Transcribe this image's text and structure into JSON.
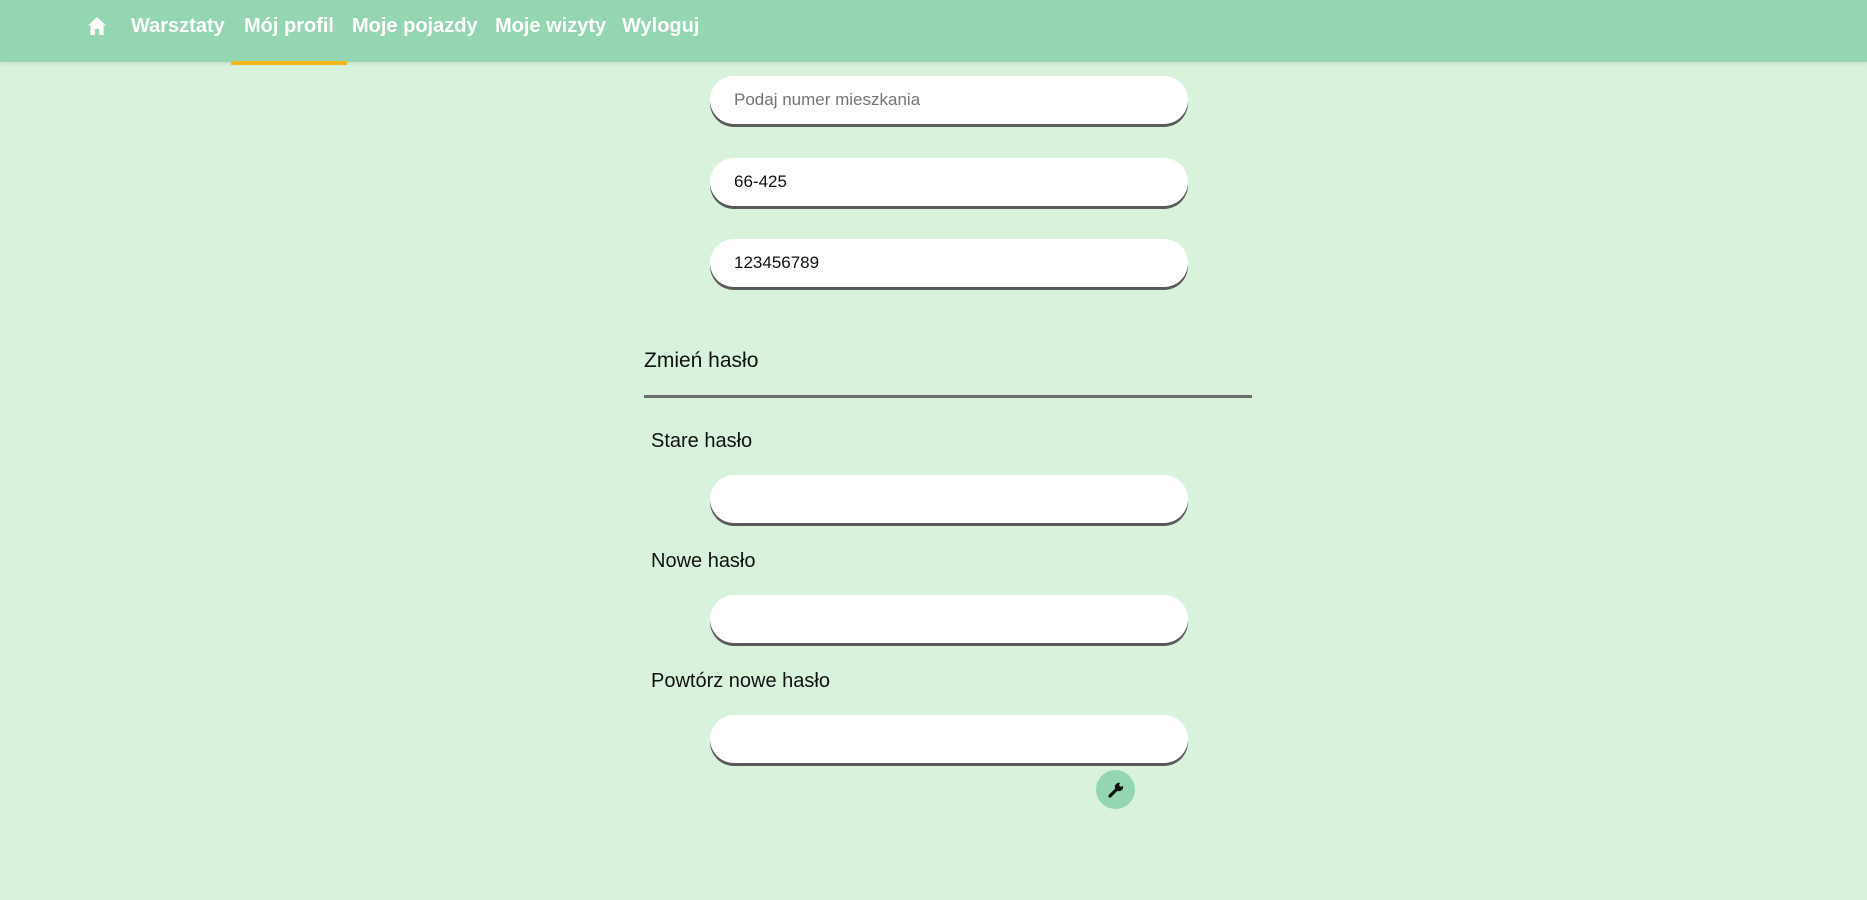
{
  "nav": {
    "home_icon": "home-icon",
    "items": [
      {
        "label": "Warsztaty",
        "active": false
      },
      {
        "label": "Mój profil",
        "active": true
      },
      {
        "label": "Moje pojazdy",
        "active": false
      },
      {
        "label": "Moje wizyty",
        "active": false
      },
      {
        "label": "Wyloguj",
        "active": false
      }
    ]
  },
  "profile": {
    "apartment": {
      "value": "",
      "placeholder": "Podaj numer mieszkania"
    },
    "postal_code": {
      "value": "66-425"
    },
    "phone": {
      "value": "123456789"
    }
  },
  "password": {
    "section_title": "Zmień hasło",
    "old_label": "Stare hasło",
    "new_label": "Nowe hasło",
    "repeat_label": "Powtórz nowe hasło",
    "submit_icon": "wrench-icon"
  },
  "colors": {
    "nav_bg": "#95d6b2",
    "page_bg": "#d8f2dc",
    "active_underline": "#f2b51a",
    "input_bg": "#ffffff",
    "input_shadow": "#5a5a5a",
    "divider": "#6d6d6d"
  }
}
